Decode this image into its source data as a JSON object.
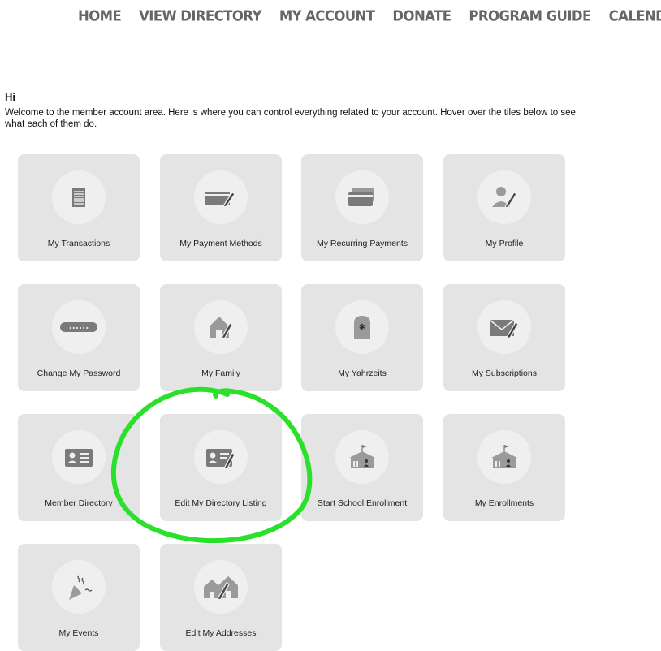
{
  "nav": {
    "items": [
      "HOME",
      "VIEW DIRECTORY",
      "MY ACCOUNT",
      "DONATE",
      "PROGRAM GUIDE",
      "CALENDAR"
    ]
  },
  "greeting": "Hi",
  "intro": "Welcome to the member account area. Here is where you can control everything related to your account. Hover over the tiles below to see what each of them do.",
  "tiles": [
    {
      "label": "My Transactions",
      "icon": "document-icon"
    },
    {
      "label": "My Payment Methods",
      "icon": "card-edit-icon"
    },
    {
      "label": "My Recurring Payments",
      "icon": "cards-icon"
    },
    {
      "label": "My Profile",
      "icon": "profile-edit-icon"
    },
    {
      "label": "Change My Password",
      "icon": "password-field-icon",
      "password_mask": "••••••"
    },
    {
      "label": "My Family",
      "icon": "house-edit-icon"
    },
    {
      "label": "My Yahrzeits",
      "icon": "tombstone-star-icon"
    },
    {
      "label": "My Subscriptions",
      "icon": "envelope-edit-icon"
    },
    {
      "label": "Member Directory",
      "icon": "id-card-icon"
    },
    {
      "label": "Edit My Directory Listing",
      "icon": "id-card-edit-icon"
    },
    {
      "label": "Start School Enrollment",
      "icon": "school-icon"
    },
    {
      "label": "My Enrollments",
      "icon": "school-icon"
    },
    {
      "label": "My Events",
      "icon": "party-popper-icon"
    },
    {
      "label": "Edit My Addresses",
      "icon": "houses-edit-icon"
    }
  ],
  "colors": {
    "tile_bg": "#e4e4e4",
    "icon_circle": "#efefef",
    "icon": "#7a7a7a",
    "nav_text": "#666666",
    "highlight": "#2be02b"
  }
}
